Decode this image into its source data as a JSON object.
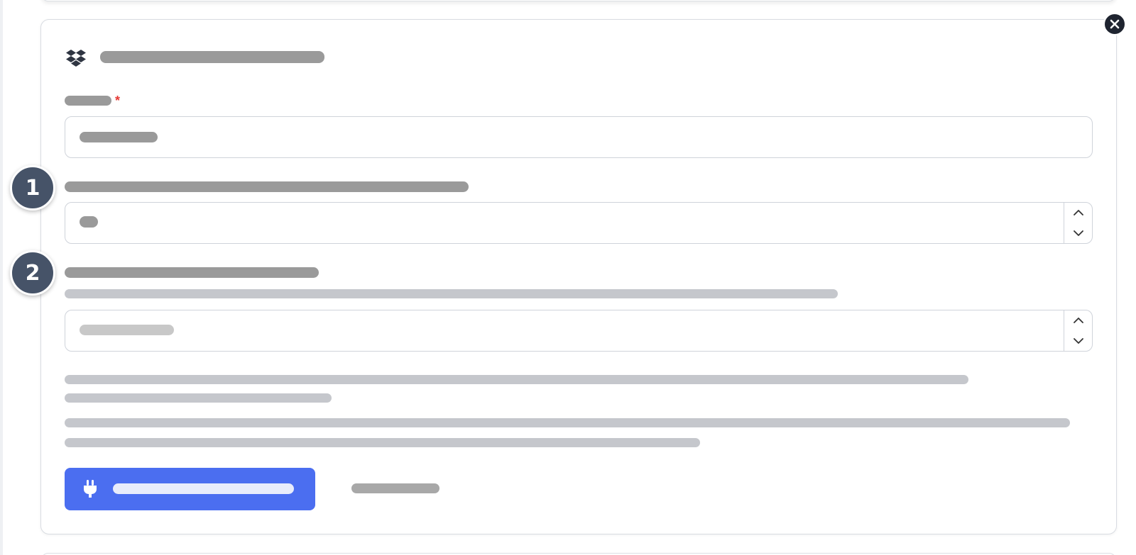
{
  "window": {
    "title": ""
  },
  "step_markers": [
    "1",
    "2"
  ],
  "form": {
    "header": {
      "icon": "dropbox-icon",
      "title": ""
    },
    "field_name": {
      "label": "",
      "required_mark": "*",
      "value": ""
    },
    "field_one": {
      "label": "",
      "value": ""
    },
    "field_two": {
      "label": "",
      "description": "",
      "placeholder": ""
    },
    "notes": [
      "",
      "",
      "",
      ""
    ],
    "actions": {
      "connect_label": "",
      "connect_icon": "plug-icon",
      "secondary_label": ""
    }
  },
  "colors": {
    "accent": "#4b6ef0",
    "step_marker": "#465368",
    "required": "#e53935",
    "close": "#1f2430"
  },
  "icons": {
    "close": "close-icon",
    "spinner_up": "chevron-up-icon",
    "spinner_down": "chevron-down-icon"
  }
}
